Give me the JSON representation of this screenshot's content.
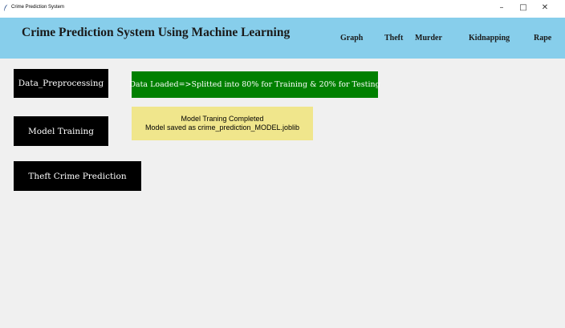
{
  "window": {
    "title": "Crime Prediction System",
    "controls": {
      "minimize": "–",
      "maximize": "□",
      "close": "✕"
    }
  },
  "header": {
    "title": "Crime Prediction System Using Machine Learning",
    "background": "#87ceeb",
    "nav": [
      {
        "label": "Graph"
      },
      {
        "label": "Theft"
      },
      {
        "label": "Murder"
      },
      {
        "label": "Kidnapping"
      },
      {
        "label": "Rape"
      }
    ]
  },
  "actions": {
    "preprocessing_label": "Data_Preprocessing",
    "training_label": "Model Training",
    "prediction_label": "Theft Crime Prediction",
    "button_color": "#000000"
  },
  "messages": {
    "data_loaded": "Data Loaded=>Splitted into 80% for Training & 20% for Testing",
    "data_loaded_color": "#008000",
    "training_line1": "Model Traning Completed",
    "training_line2": "Model saved as crime_prediction_MODEL.joblib",
    "training_color": "#f0e68c"
  },
  "icons": {
    "app_icon": "feather-icon"
  }
}
